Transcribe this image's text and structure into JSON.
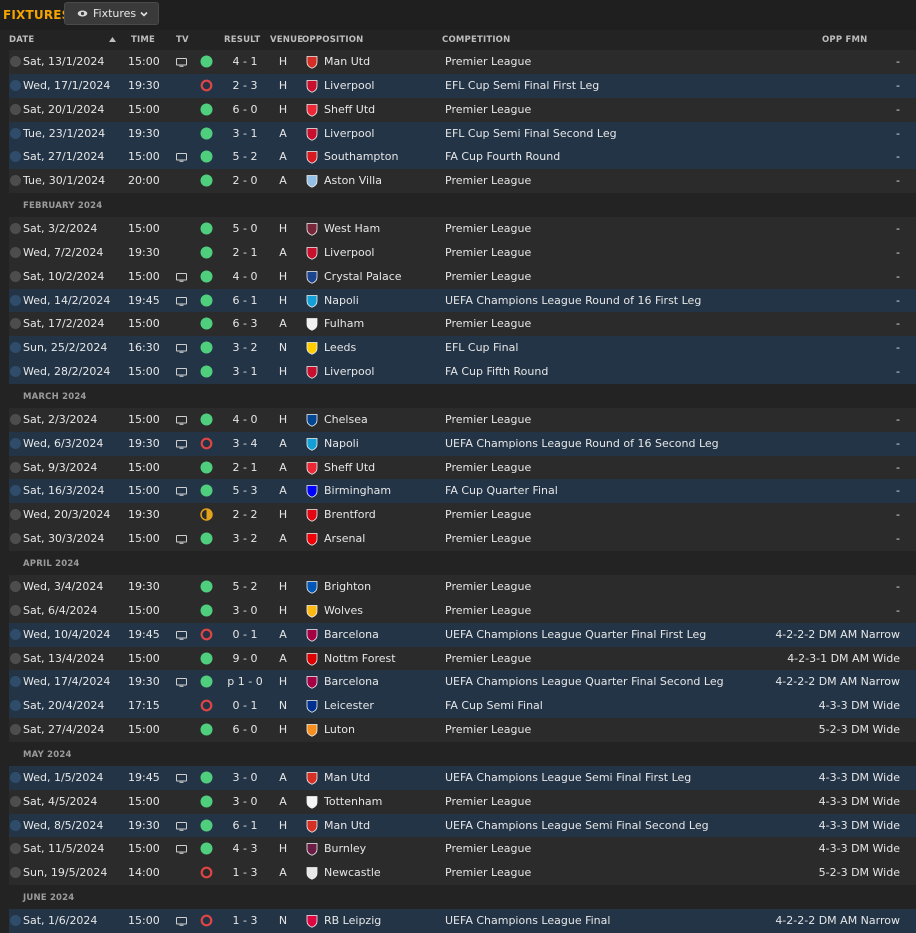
{
  "page": {
    "title": "FIXTURES",
    "view_label": "Fixtures"
  },
  "columns": {
    "date": "DATE",
    "time": "TIME",
    "tv": "TV",
    "result": "RESULT",
    "venue": "VENUE",
    "opposition": "OPPOSITION",
    "competition": "COMPETITION",
    "opp_fmn": "OPP FMN"
  },
  "status_colors": {
    "win": "#4fcf7d",
    "loss": "#e04444",
    "draw": "#e3a21a"
  },
  "rows": [
    {
      "type": "fixture",
      "date": "Sat, 13/1/2024",
      "time": "15:00",
      "tv": true,
      "status": "win",
      "result": "4 - 1",
      "venue": "H",
      "opp": "Man Utd",
      "crest": "#d62f25",
      "comp": "Premier League",
      "fmn": "-",
      "shade": "dark"
    },
    {
      "type": "fixture",
      "date": "Wed, 17/1/2024",
      "time": "19:30",
      "tv": false,
      "status": "loss",
      "result": "2 - 3",
      "venue": "H",
      "opp": "Liverpool",
      "crest": "#c8102e",
      "comp": "EFL Cup Semi Final First Leg",
      "fmn": "-",
      "shade": "blue"
    },
    {
      "type": "fixture",
      "date": "Sat, 20/1/2024",
      "time": "15:00",
      "tv": false,
      "status": "win",
      "result": "6 - 0",
      "venue": "H",
      "opp": "Sheff Utd",
      "crest": "#ee2737",
      "comp": "Premier League",
      "fmn": "-",
      "shade": "dark"
    },
    {
      "type": "fixture",
      "date": "Tue, 23/1/2024",
      "time": "19:30",
      "tv": false,
      "status": "win",
      "result": "3 - 1",
      "venue": "A",
      "opp": "Liverpool",
      "crest": "#c8102e",
      "comp": "EFL Cup Semi Final Second Leg",
      "fmn": "-",
      "shade": "blue"
    },
    {
      "type": "fixture",
      "date": "Sat, 27/1/2024",
      "time": "15:00",
      "tv": true,
      "status": "win",
      "result": "5 - 2",
      "venue": "A",
      "opp": "Southampton",
      "crest": "#d71920",
      "comp": "FA Cup Fourth Round",
      "fmn": "-",
      "shade": "blue"
    },
    {
      "type": "fixture",
      "date": "Tue, 30/1/2024",
      "time": "20:00",
      "tv": false,
      "status": "win",
      "result": "2 - 0",
      "venue": "A",
      "opp": "Aston Villa",
      "crest": "#95bfe5",
      "comp": "Premier League",
      "fmn": "-",
      "shade": "dark"
    },
    {
      "type": "month",
      "label": "FEBRUARY 2024"
    },
    {
      "type": "fixture",
      "date": "Sat, 3/2/2024",
      "time": "15:00",
      "tv": false,
      "status": "win",
      "result": "5 - 0",
      "venue": "H",
      "opp": "West Ham",
      "crest": "#7a263a",
      "comp": "Premier League",
      "fmn": "-",
      "shade": "dark"
    },
    {
      "type": "fixture",
      "date": "Wed, 7/2/2024",
      "time": "19:30",
      "tv": false,
      "status": "win",
      "result": "2 - 1",
      "venue": "A",
      "opp": "Liverpool",
      "crest": "#c8102e",
      "comp": "Premier League",
      "fmn": "-",
      "shade": "dark"
    },
    {
      "type": "fixture",
      "date": "Sat, 10/2/2024",
      "time": "15:00",
      "tv": true,
      "status": "win",
      "result": "4 - 0",
      "venue": "H",
      "opp": "Crystal Palace",
      "crest": "#1b458f",
      "comp": "Premier League",
      "fmn": "-",
      "shade": "dark"
    },
    {
      "type": "fixture",
      "date": "Wed, 14/2/2024",
      "time": "19:45",
      "tv": true,
      "status": "win",
      "result": "6 - 1",
      "venue": "H",
      "opp": "Napoli",
      "crest": "#12a0d7",
      "comp": "UEFA Champions League Round of 16 First Leg",
      "fmn": "-",
      "shade": "blue"
    },
    {
      "type": "fixture",
      "date": "Sat, 17/2/2024",
      "time": "15:00",
      "tv": false,
      "status": "win",
      "result": "6 - 3",
      "venue": "A",
      "opp": "Fulham",
      "crest": "#f2f2f2",
      "comp": "Premier League",
      "fmn": "-",
      "shade": "dark"
    },
    {
      "type": "fixture",
      "date": "Sun, 25/2/2024",
      "time": "16:30",
      "tv": true,
      "status": "win",
      "result": "3 - 2",
      "venue": "N",
      "opp": "Leeds",
      "crest": "#ffcd00",
      "comp": "EFL Cup Final",
      "fmn": "-",
      "shade": "blue"
    },
    {
      "type": "fixture",
      "date": "Wed, 28/2/2024",
      "time": "15:00",
      "tv": true,
      "status": "win",
      "result": "3 - 1",
      "venue": "H",
      "opp": "Liverpool",
      "crest": "#c8102e",
      "comp": "FA Cup Fifth Round",
      "fmn": "-",
      "shade": "blue"
    },
    {
      "type": "month",
      "label": "MARCH 2024"
    },
    {
      "type": "fixture",
      "date": "Sat, 2/3/2024",
      "time": "15:00",
      "tv": true,
      "status": "win",
      "result": "4 - 0",
      "venue": "H",
      "opp": "Chelsea",
      "crest": "#034694",
      "comp": "Premier League",
      "fmn": "-",
      "shade": "dark"
    },
    {
      "type": "fixture",
      "date": "Wed, 6/3/2024",
      "time": "19:30",
      "tv": true,
      "status": "loss",
      "result": "3 - 4",
      "venue": "A",
      "opp": "Napoli",
      "crest": "#12a0d7",
      "comp": "UEFA Champions League Round of 16 Second Leg",
      "fmn": "-",
      "shade": "blue"
    },
    {
      "type": "fixture",
      "date": "Sat, 9/3/2024",
      "time": "15:00",
      "tv": false,
      "status": "win",
      "result": "2 - 1",
      "venue": "A",
      "opp": "Sheff Utd",
      "crest": "#ee2737",
      "comp": "Premier League",
      "fmn": "-",
      "shade": "dark"
    },
    {
      "type": "fixture",
      "date": "Sat, 16/3/2024",
      "time": "15:00",
      "tv": true,
      "status": "win",
      "result": "5 - 3",
      "venue": "A",
      "opp": "Birmingham",
      "crest": "#0000ff",
      "comp": "FA Cup Quarter Final",
      "fmn": "-",
      "shade": "blue"
    },
    {
      "type": "fixture",
      "date": "Wed, 20/3/2024",
      "time": "19:30",
      "tv": false,
      "status": "draw",
      "result": "2 - 2",
      "venue": "H",
      "opp": "Brentford",
      "crest": "#e30613",
      "comp": "Premier League",
      "fmn": "-",
      "shade": "dark"
    },
    {
      "type": "fixture",
      "date": "Sat, 30/3/2024",
      "time": "15:00",
      "tv": true,
      "status": "win",
      "result": "3 - 2",
      "venue": "A",
      "opp": "Arsenal",
      "crest": "#ef0107",
      "comp": "Premier League",
      "fmn": "-",
      "shade": "dark"
    },
    {
      "type": "month",
      "label": "APRIL 2024"
    },
    {
      "type": "fixture",
      "date": "Wed, 3/4/2024",
      "time": "19:30",
      "tv": false,
      "status": "win",
      "result": "5 - 2",
      "venue": "H",
      "opp": "Brighton",
      "crest": "#0057b8",
      "comp": "Premier League",
      "fmn": "-",
      "shade": "dark"
    },
    {
      "type": "fixture",
      "date": "Sat, 6/4/2024",
      "time": "15:00",
      "tv": false,
      "status": "win",
      "result": "3 - 0",
      "venue": "H",
      "opp": "Wolves",
      "crest": "#fdb913",
      "comp": "Premier League",
      "fmn": "-",
      "shade": "dark"
    },
    {
      "type": "fixture",
      "date": "Wed, 10/4/2024",
      "time": "19:45",
      "tv": true,
      "status": "loss",
      "result": "0 - 1",
      "venue": "A",
      "opp": "Barcelona",
      "crest": "#a50044",
      "comp": "UEFA Champions League Quarter Final First Leg",
      "fmn": "4-2-2-2 DM AM Narrow",
      "shade": "blue"
    },
    {
      "type": "fixture",
      "date": "Sat, 13/4/2024",
      "time": "15:00",
      "tv": false,
      "status": "win",
      "result": "9 - 0",
      "venue": "A",
      "opp": "Nottm Forest",
      "crest": "#dd0000",
      "comp": "Premier League",
      "fmn": "4-2-3-1 DM AM Wide",
      "shade": "dark"
    },
    {
      "type": "fixture",
      "date": "Wed, 17/4/2024",
      "time": "19:30",
      "tv": true,
      "status": "win",
      "result": "p 1 - 0",
      "venue": "H",
      "opp": "Barcelona",
      "crest": "#a50044",
      "comp": "UEFA Champions League Quarter Final Second Leg",
      "fmn": "4-2-2-2 DM AM Narrow",
      "shade": "blue"
    },
    {
      "type": "fixture",
      "date": "Sat, 20/4/2024",
      "time": "17:15",
      "tv": false,
      "status": "loss",
      "result": "0 - 1",
      "venue": "N",
      "opp": "Leicester",
      "crest": "#003090",
      "comp": "FA Cup Semi Final",
      "fmn": "4-3-3 DM Wide",
      "shade": "blue"
    },
    {
      "type": "fixture",
      "date": "Sat, 27/4/2024",
      "time": "15:00",
      "tv": false,
      "status": "win",
      "result": "6 - 0",
      "venue": "H",
      "opp": "Luton",
      "crest": "#f78f1e",
      "comp": "Premier League",
      "fmn": "5-2-3 DM Wide",
      "shade": "dark"
    },
    {
      "type": "month",
      "label": "MAY 2024"
    },
    {
      "type": "fixture",
      "date": "Wed, 1/5/2024",
      "time": "19:45",
      "tv": true,
      "status": "win",
      "result": "3 - 0",
      "venue": "A",
      "opp": "Man Utd",
      "crest": "#d62f25",
      "comp": "UEFA Champions League Semi Final First Leg",
      "fmn": "4-3-3 DM Wide",
      "shade": "blue"
    },
    {
      "type": "fixture",
      "date": "Sat, 4/5/2024",
      "time": "15:00",
      "tv": false,
      "status": "win",
      "result": "3 - 0",
      "venue": "A",
      "opp": "Tottenham",
      "crest": "#f5f5f5",
      "comp": "Premier League",
      "fmn": "4-3-3 DM Wide",
      "shade": "dark"
    },
    {
      "type": "fixture",
      "date": "Wed, 8/5/2024",
      "time": "19:30",
      "tv": true,
      "status": "win",
      "result": "6 - 1",
      "venue": "H",
      "opp": "Man Utd",
      "crest": "#d62f25",
      "comp": "UEFA Champions League Semi Final Second Leg",
      "fmn": "4-3-3 DM Wide",
      "shade": "blue"
    },
    {
      "type": "fixture",
      "date": "Sat, 11/5/2024",
      "time": "15:00",
      "tv": true,
      "status": "win",
      "result": "4 - 3",
      "venue": "H",
      "opp": "Burnley",
      "crest": "#6c1d45",
      "comp": "Premier League",
      "fmn": "4-3-3 DM Wide",
      "shade": "dark"
    },
    {
      "type": "fixture",
      "date": "Sun, 19/5/2024",
      "time": "14:00",
      "tv": false,
      "status": "loss",
      "result": "1 - 3",
      "venue": "A",
      "opp": "Newcastle",
      "crest": "#e8e8e8",
      "comp": "Premier League",
      "fmn": "5-2-3 DM Wide",
      "shade": "dark"
    },
    {
      "type": "month",
      "label": "JUNE 2024"
    },
    {
      "type": "fixture",
      "date": "Sat, 1/6/2024",
      "time": "15:00",
      "tv": true,
      "status": "loss",
      "result": "1 - 3",
      "venue": "N",
      "opp": "RB Leipzig",
      "crest": "#dd0741",
      "comp": "UEFA Champions League Final",
      "fmn": "4-2-2-2 DM AM Narrow",
      "shade": "blue"
    }
  ]
}
